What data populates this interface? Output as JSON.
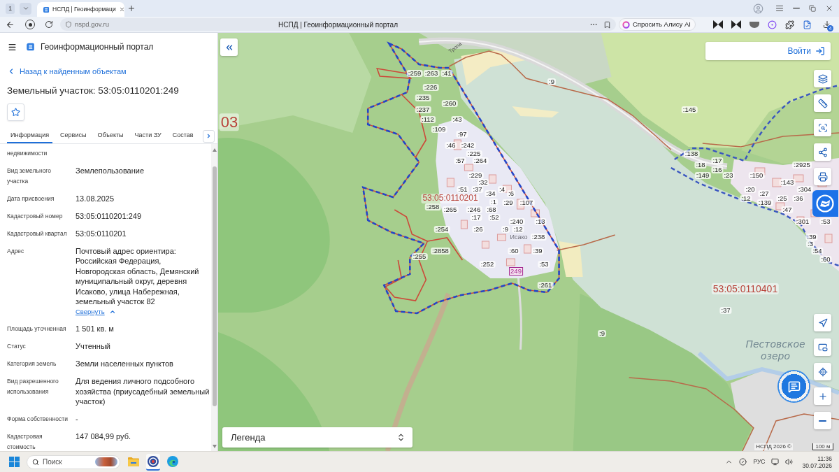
{
  "browser": {
    "tab_count": "1",
    "tabs": [
      {
        "title": "НСПД | Геоинформаци",
        "selected": true
      }
    ],
    "url": "nspd.gov.ru",
    "page_title": "НСПД | Геоинформационный портал",
    "assistant_button": "Спросить Алису AI",
    "downloads_badge": "4"
  },
  "app": {
    "title": "Геоинформационный портал"
  },
  "panel": {
    "back_link": "Назад к найденным объектам",
    "heading": "Земельный участок: 53:05:0110201:249",
    "tabs": [
      {
        "label": "Информация",
        "selected": true
      },
      {
        "label": "Сервисы",
        "selected": false
      },
      {
        "label": "Объекты",
        "selected": false
      },
      {
        "label": "Части ЗУ",
        "selected": false
      },
      {
        "label": "Состав",
        "selected": false
      }
    ],
    "fields": [
      {
        "label": "недвижимости"
      },
      {
        "label": "Вид земельного участка",
        "value": "Землепользование"
      },
      {
        "label": "Дата присвоения",
        "value": "13.08.2025"
      },
      {
        "label": "Кадастровый номер",
        "value": "53:05:0110201:249"
      },
      {
        "label": "Кадастровый квартал",
        "value": "53:05:0110201"
      },
      {
        "label": "Адрес",
        "value": "Почтовый адрес ориентира: Российская Федерация, Новгородская область, Демянский муниципальный округ, деревня Исаково, улица Набережная, земельный участок 82",
        "link": "Свернуть",
        "expanded": true
      },
      {
        "label": "Площадь уточненная",
        "value": "1 501 кв. м"
      },
      {
        "label": "Статус",
        "value": "Учтенный"
      },
      {
        "label": "Категория земель",
        "value": "Земли населенных пунктов"
      },
      {
        "label": "Вид разрешенного использования",
        "value": "Для ведения личного подсобного хозяйства (приусадебный земельный участок)"
      },
      {
        "label": "Форма собственности",
        "value": "-"
      },
      {
        "label": "Кадастровая стоимость",
        "value": "147 084,99 руб."
      }
    ]
  },
  "map": {
    "login_button": "Войти",
    "legend": "Легенда",
    "attribution": "НСПД 2026 ©",
    "scale": "100 м",
    "labels": [
      {
        "text": "Тропа",
        "kind": "street"
      },
      {
        "text": ":259",
        "kind": "plot"
      },
      {
        "text": ":263",
        "kind": "plot"
      },
      {
        "text": ":41",
        "kind": "plot"
      },
      {
        "text": ":9",
        "kind": "plot"
      },
      {
        "text": ":226",
        "kind": "plot"
      },
      {
        "text": ":235",
        "kind": "plot"
      },
      {
        "text": ":260",
        "kind": "plot"
      },
      {
        "text": ":237",
        "kind": "plot"
      },
      {
        "text": ":145",
        "kind": "plot"
      },
      {
        "text": "03",
        "kind": "quarter"
      },
      {
        "text": ":112",
        "kind": "plot"
      },
      {
        "text": ":43",
        "kind": "plot"
      },
      {
        "text": ":109",
        "kind": "plot"
      },
      {
        "text": ":97",
        "kind": "plot"
      },
      {
        "text": ":46",
        "kind": "plot"
      },
      {
        "text": ":242",
        "kind": "plot"
      },
      {
        "text": ":225",
        "kind": "plot"
      },
      {
        "text": ":138",
        "kind": "plot"
      },
      {
        "text": ":57",
        "kind": "plot"
      },
      {
        "text": ":264",
        "kind": "plot"
      },
      {
        "text": ":17",
        "kind": "plot"
      },
      {
        "text": ":18",
        "kind": "plot"
      },
      {
        "text": ":2925",
        "kind": "plot"
      },
      {
        "text": ":16",
        "kind": "plot"
      },
      {
        "text": ":229",
        "kind": "plot"
      },
      {
        "text": ":149",
        "kind": "plot"
      },
      {
        "text": ":23",
        "kind": "plot"
      },
      {
        "text": ":150",
        "kind": "plot"
      },
      {
        "text": ":32",
        "kind": "plot"
      },
      {
        "text": ":143",
        "kind": "plot"
      },
      {
        "text": ":51",
        "kind": "plot"
      },
      {
        "text": ":37",
        "kind": "plot"
      },
      {
        "text": ":4",
        "kind": "plot"
      },
      {
        "text": ":20",
        "kind": "plot"
      },
      {
        "text": ":304",
        "kind": "plot"
      },
      {
        "text": ":34",
        "kind": "plot"
      },
      {
        "text": ":6",
        "kind": "plot"
      },
      {
        "text": ":27",
        "kind": "plot"
      },
      {
        "text": "53:05:0110201",
        "kind": "quarter"
      },
      {
        "text": ":12",
        "kind": "plot"
      },
      {
        "text": ":25",
        "kind": "plot"
      },
      {
        "text": ":36",
        "kind": "plot"
      },
      {
        "text": ":1",
        "kind": "plot"
      },
      {
        "text": ":29",
        "kind": "plot"
      },
      {
        "text": ":107",
        "kind": "plot"
      },
      {
        "text": ":139",
        "kind": "plot"
      },
      {
        "text": ":258",
        "kind": "plot"
      },
      {
        "text": ":265",
        "kind": "plot"
      },
      {
        "text": ":246",
        "kind": "plot"
      },
      {
        "text": ":68",
        "kind": "plot"
      },
      {
        "text": ":47",
        "kind": "plot"
      },
      {
        "text": ":17",
        "kind": "plot"
      },
      {
        "text": ":52",
        "kind": "plot"
      },
      {
        "text": ":240",
        "kind": "plot"
      },
      {
        "text": ":13",
        "kind": "plot"
      },
      {
        "text": ":301",
        "kind": "plot"
      },
      {
        "text": ":53",
        "kind": "plot"
      },
      {
        "text": ":254",
        "kind": "plot"
      },
      {
        "text": ":26",
        "kind": "plot"
      },
      {
        "text": ":9",
        "kind": "plot"
      },
      {
        "text": ":12",
        "kind": "plot"
      },
      {
        "text": "Исако",
        "kind": "locality"
      },
      {
        "text": ":238",
        "kind": "plot"
      },
      {
        "text": ":39",
        "kind": "plot"
      },
      {
        "text": ":3",
        "kind": "plot"
      },
      {
        "text": ":2858",
        "kind": "plot"
      },
      {
        "text": ":60",
        "kind": "plot"
      },
      {
        "text": ":39",
        "kind": "plot"
      },
      {
        "text": ":54",
        "kind": "plot"
      },
      {
        "text": ":255",
        "kind": "plot"
      },
      {
        "text": ":60",
        "kind": "plot"
      },
      {
        "text": ":252",
        "kind": "plot"
      },
      {
        "text": ":53",
        "kind": "plot"
      },
      {
        "text": "249",
        "kind": "highlight"
      },
      {
        "text": ":261",
        "kind": "plot"
      },
      {
        "text": "53:05:0110401",
        "kind": "quarter"
      },
      {
        "text": ":37",
        "kind": "plot"
      },
      {
        "text": ":9",
        "kind": "plot"
      },
      {
        "text": "Пестовское озеро",
        "kind": "lake"
      }
    ]
  },
  "taskbar": {
    "search": {
      "placeholder": "Поиск"
    },
    "apps": [
      {
        "kind": "folder",
        "selected": false
      },
      {
        "kind": "browser",
        "selected": true
      },
      {
        "kind": "swirl",
        "selected": false
      }
    ],
    "language": "РУС",
    "time": "11:36",
    "date": "30.07.2026"
  }
}
